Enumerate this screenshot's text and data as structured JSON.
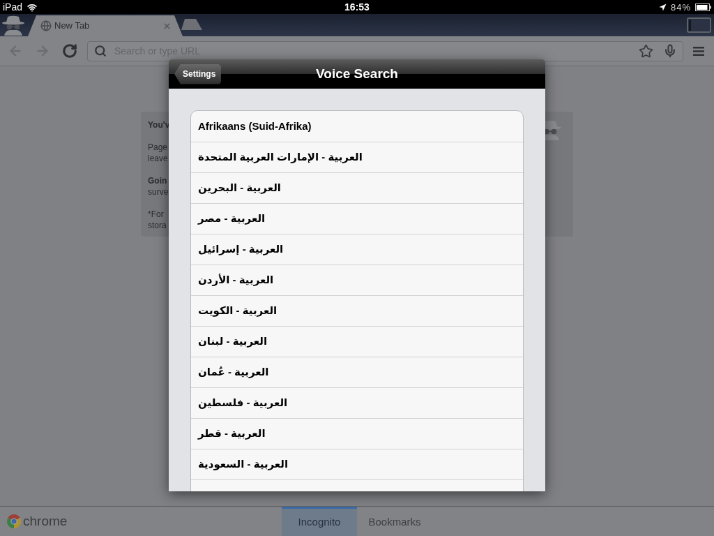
{
  "status_bar": {
    "carrier": "iPad",
    "time": "16:53",
    "battery": "84%"
  },
  "tab_strip": {
    "tabs": [
      {
        "title": "New Tab",
        "selected": true
      }
    ]
  },
  "toolbar": {
    "buttons": [
      {
        "kind": "back",
        "disabled": true
      },
      {
        "kind": "forward",
        "disabled": true
      },
      {
        "kind": "reload",
        "disabled": false
      }
    ],
    "omnibox": {
      "placeholder": "Search or type URL"
    }
  },
  "incognito_card": {
    "paragraphs": [
      {
        "lines": [
          {
            "text": "You'v",
            "bold": true
          }
        ]
      },
      {
        "lines": [
          {
            "text": "Page",
            "bold": false
          },
          {
            "text": "leave",
            "bold": false
          }
        ]
      },
      {
        "lines": [
          {
            "text": "Goin",
            "bold": true
          },
          {
            "text": "surve",
            "bold": false
          }
        ]
      },
      {
        "lines": [
          {
            "text": "*For",
            "bold": false
          },
          {
            "text": "stora",
            "bold": false
          }
        ]
      }
    ]
  },
  "dialog": {
    "back_button": "Settings",
    "title": "Voice Search",
    "languages": [
      "Afrikaans (Suid-Afrika)",
      "العربية - الإمارات العربية المتحدة",
      "العربية - البحرين",
      "العربية - مصر",
      "العربية - إسرائيل",
      "العربية - الأردن",
      "العربية - الكويت",
      "العربية - لبنان",
      "العربية - عُمان",
      "العربية - فلسطين",
      "العربية - قطر",
      "العربية - السعودية"
    ]
  },
  "bottom_bar": {
    "logo": "chrome",
    "incognito_tab": {
      "label": "Incognito",
      "selected": true
    },
    "bookmarks_tab": {
      "label": "Bookmarks",
      "selected": false
    }
  }
}
